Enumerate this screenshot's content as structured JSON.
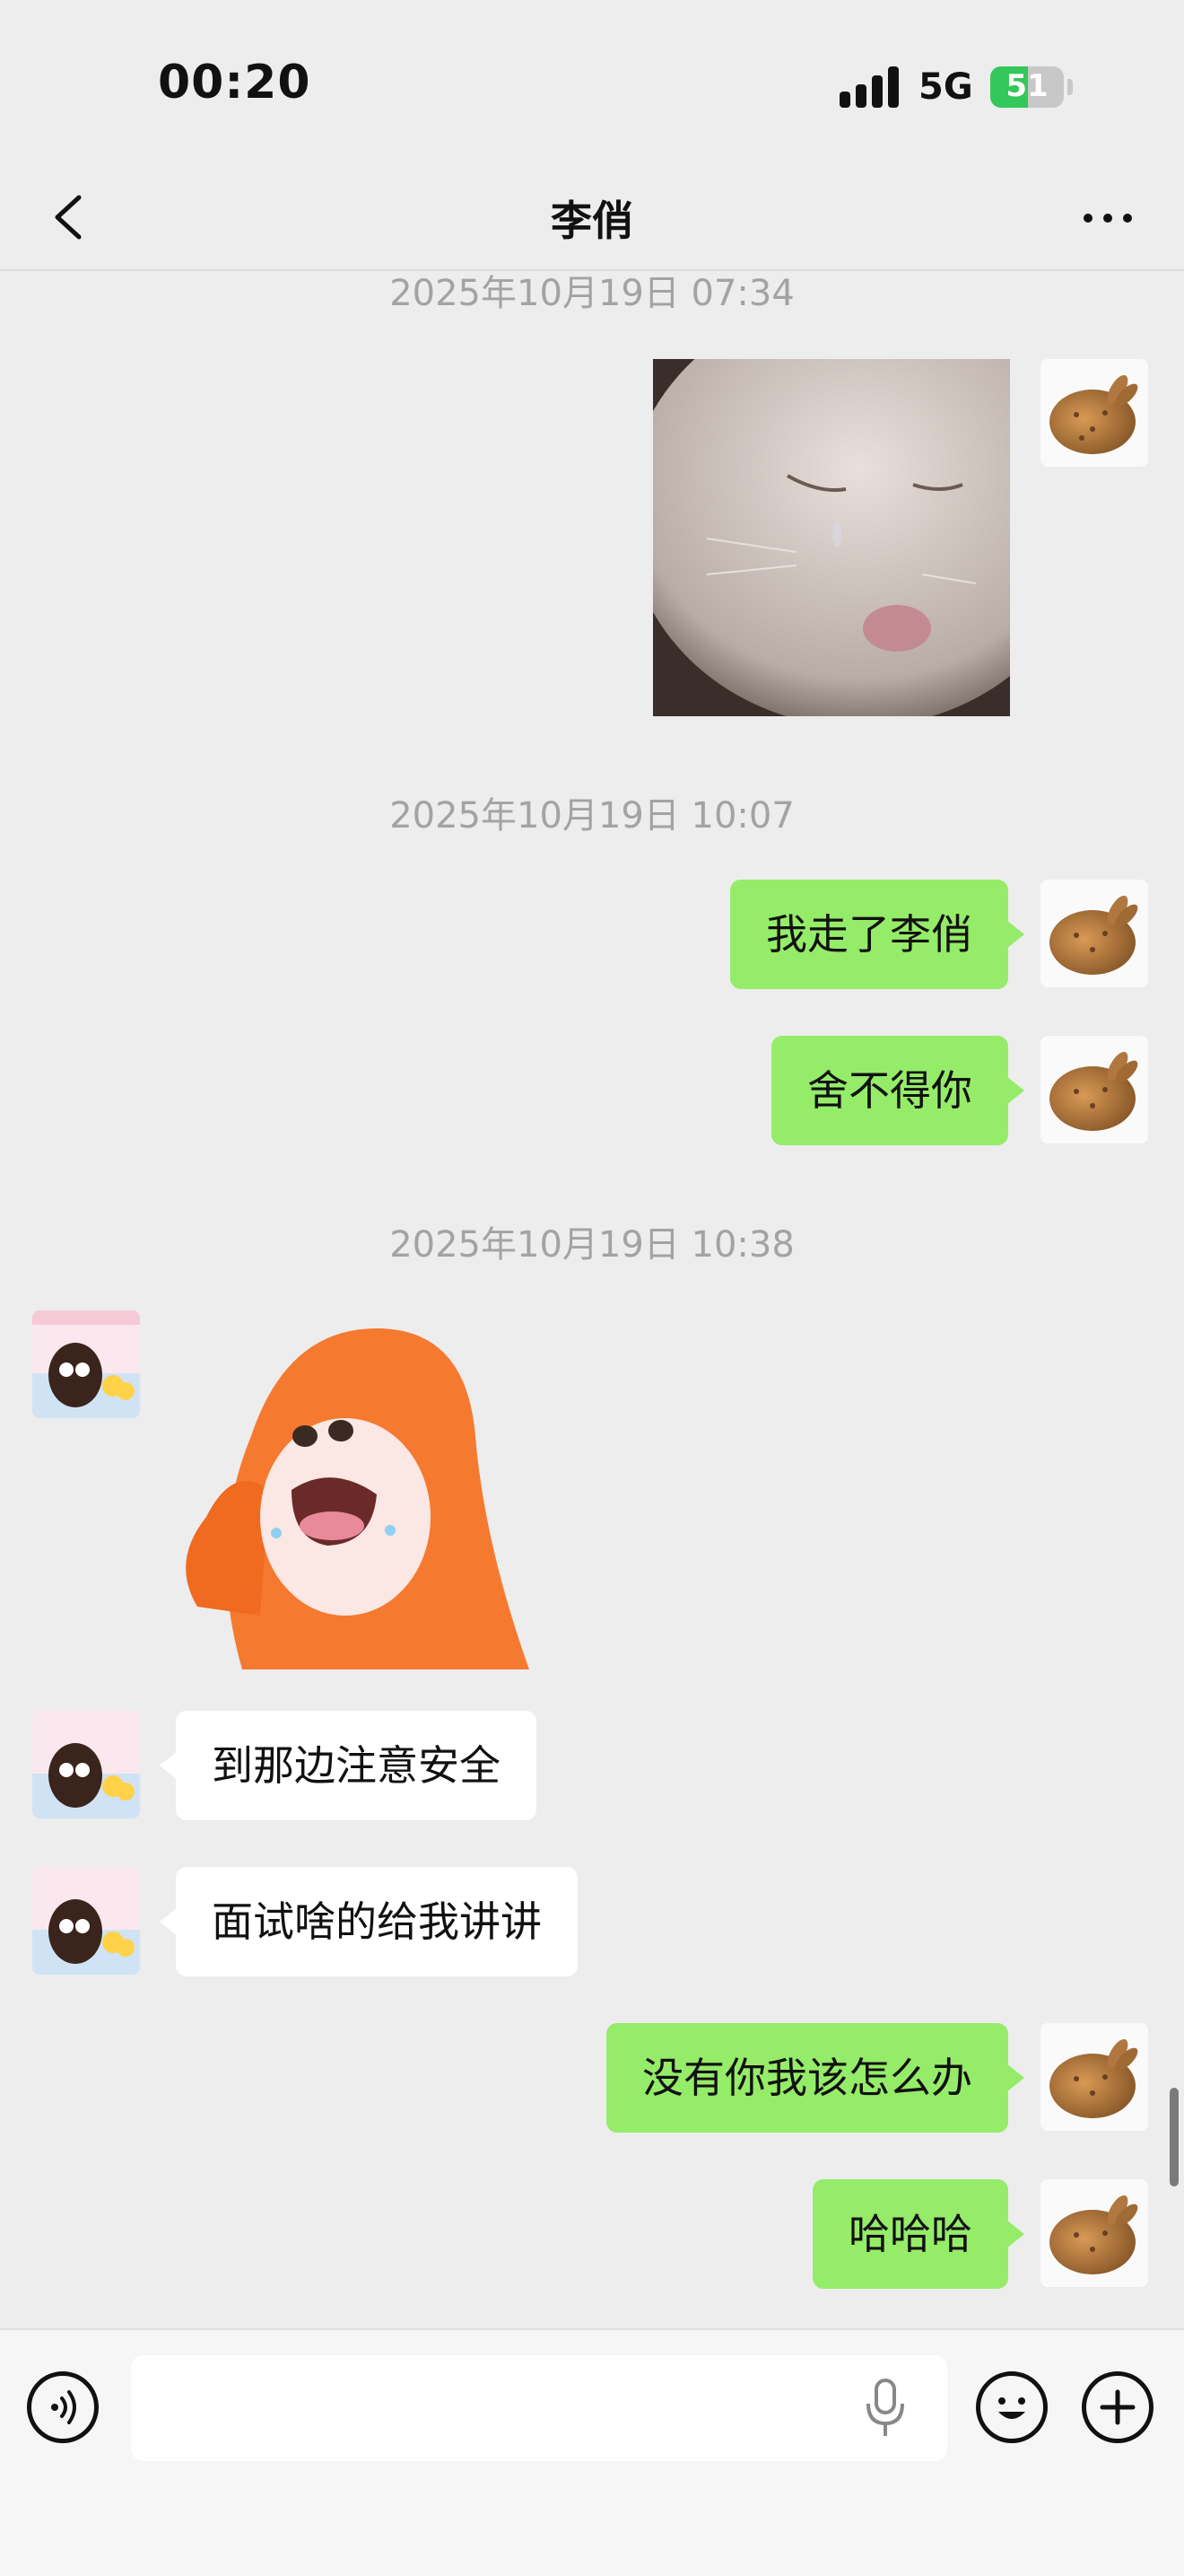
{
  "status_bar": {
    "time": "00:20",
    "network": "5G",
    "battery": "51",
    "battery_level": 0.51
  },
  "header": {
    "title": "李俏"
  },
  "messages": [
    {
      "type": "timestamp",
      "text": "2025年10月19日 07:34"
    },
    {
      "type": "image",
      "side": "right"
    },
    {
      "type": "timestamp",
      "text": "2025年10月19日 10:07"
    },
    {
      "type": "text",
      "side": "right",
      "text": "我走了李俏"
    },
    {
      "type": "text",
      "side": "right",
      "text": "舍不得你"
    },
    {
      "type": "timestamp",
      "text": "2025年10月19日 10:38"
    },
    {
      "type": "sticker",
      "side": "left"
    },
    {
      "type": "text",
      "side": "left",
      "text": "到那边注意安全"
    },
    {
      "type": "text",
      "side": "left",
      "text": "面试啥的给我讲讲"
    },
    {
      "type": "text",
      "side": "right",
      "text": "没有你我该怎么办"
    },
    {
      "type": "text",
      "side": "right",
      "text": "哈哈哈"
    }
  ],
  "input_bar": {
    "value": "",
    "left_icon": "voice-icon",
    "mic_icon": "microphone-icon",
    "emoji_icon": "emoji-icon",
    "plus_icon": "plus-icon"
  },
  "colors": {
    "background": "#ededed",
    "my_bubble": "#95ec69",
    "their_bubble": "#ffffff",
    "battery_green": "#34c759",
    "timestamp": "#a3a3a3"
  }
}
